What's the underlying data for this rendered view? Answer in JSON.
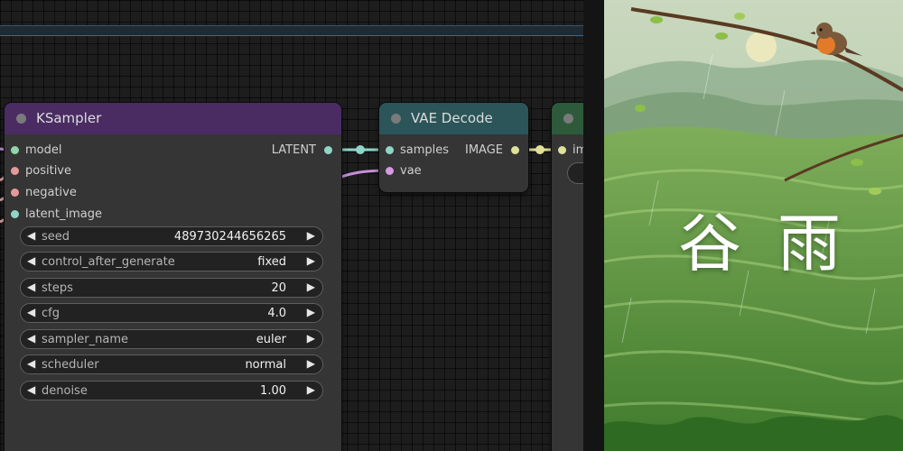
{
  "ksampler": {
    "title": "KSampler",
    "inputs": [
      {
        "name": "model",
        "color": "#8fd6a8"
      },
      {
        "name": "positive",
        "color": "#e59a9a"
      },
      {
        "name": "negative",
        "color": "#e59a9a"
      },
      {
        "name": "latent_image",
        "color": "#8fd6c8"
      }
    ],
    "output": {
      "name": "LATENT",
      "color": "#8fd6c8"
    },
    "widgets": [
      {
        "name": "seed",
        "value": "489730244656265"
      },
      {
        "name": "control_after_generate",
        "value": "fixed"
      },
      {
        "name": "steps",
        "value": "20"
      },
      {
        "name": "cfg",
        "value": "4.0"
      },
      {
        "name": "sampler_name",
        "value": "euler"
      },
      {
        "name": "scheduler",
        "value": "normal"
      },
      {
        "name": "denoise",
        "value": "1.00"
      }
    ]
  },
  "vae_decode": {
    "title": "VAE Decode",
    "inputs": [
      {
        "name": "samples",
        "color": "#8fd6c8"
      },
      {
        "name": "vae",
        "color": "#d59ae0"
      }
    ],
    "output": {
      "name": "IMAGE",
      "color": "#e0e09a"
    }
  },
  "save_node": {
    "input_partial": "im"
  },
  "poster": {
    "char1": "谷",
    "char2": "雨"
  },
  "colors": {
    "ksampler_header": "#4a2c63",
    "vae_header": "#2b5559",
    "save_header": "#2d5a3a",
    "latent_wire": "#8fd6c8",
    "vae_wire": "#c48fd9",
    "image_wire": "#e0e09a"
  }
}
